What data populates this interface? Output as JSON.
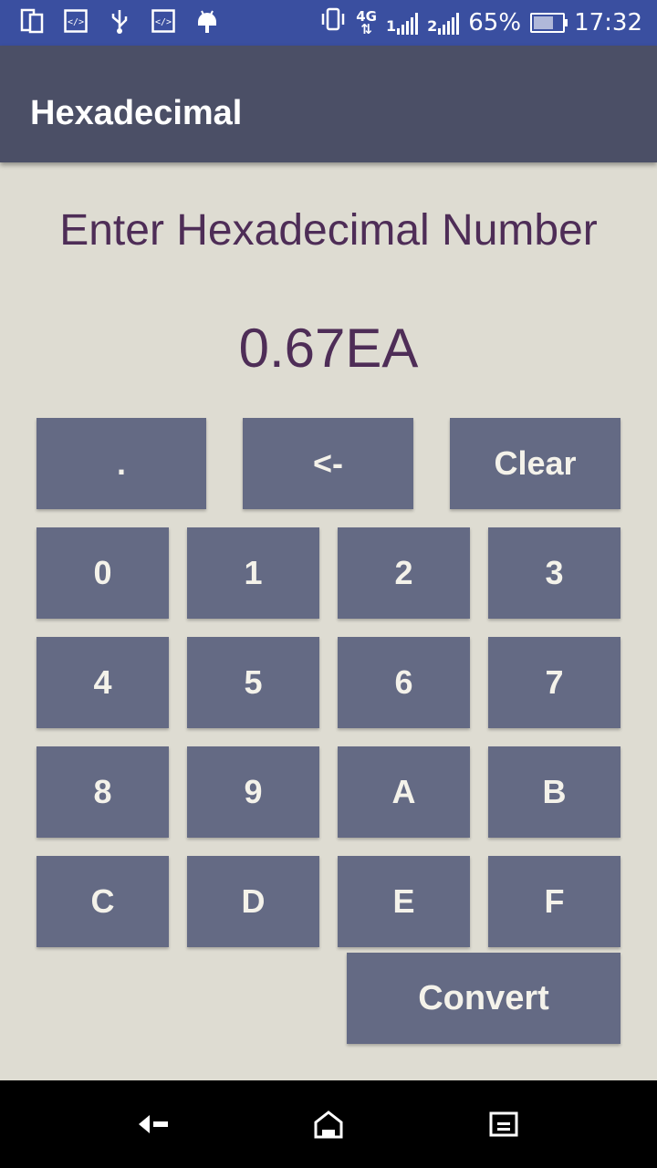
{
  "status_bar": {
    "signal_label_1": "1",
    "network_type": "4G",
    "signal_label_2": "2",
    "battery_percent": "65%",
    "time": "17:32",
    "left_icons": [
      "screen-icon",
      "code-icon",
      "usb-icon",
      "code-icon",
      "android-icon"
    ]
  },
  "toolbar": {
    "title": "Hexadecimal"
  },
  "main": {
    "prompt": "Enter Hexadecimal Number",
    "display_value": "0.67EA"
  },
  "keypad": {
    "dot": ".",
    "backspace": "<-",
    "clear": "Clear",
    "digits": [
      "0",
      "1",
      "2",
      "3",
      "4",
      "5",
      "6",
      "7",
      "8",
      "9",
      "A",
      "B",
      "C",
      "D",
      "E",
      "F"
    ],
    "convert": "Convert"
  },
  "nav_bar": {
    "icons": [
      "back-icon",
      "home-icon",
      "recents-icon"
    ]
  },
  "colors": {
    "status_bar": "#3a4fa0",
    "toolbar": "#4b4f66",
    "background": "#dedcd2",
    "key": "#646a84",
    "key_text": "#f4f2ea",
    "heading_text": "#4e2d57"
  }
}
